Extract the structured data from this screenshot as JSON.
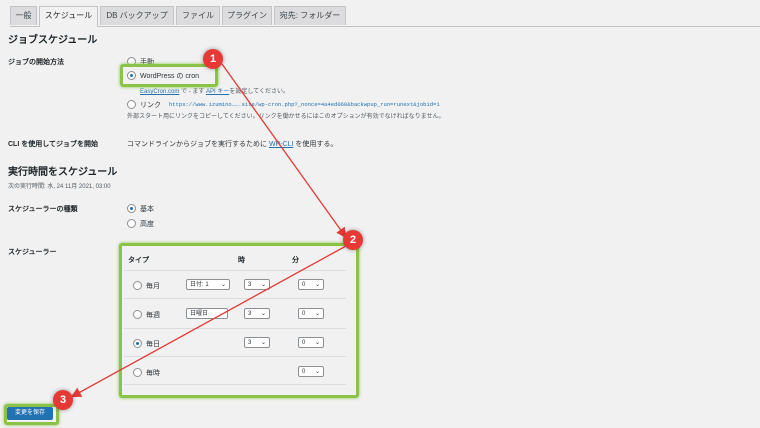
{
  "tabs": [
    "一般",
    "スケジュール",
    "DB バックアップ",
    "ファイル",
    "プラグイン",
    "宛先: フォルダー"
  ],
  "section_job_schedule": "ジョブスケジュール",
  "start_method_label": "ジョブの開始方法",
  "start_options": {
    "first": "手動",
    "wpcron": "WordPress の cron",
    "easycron_note": {
      "link1": "EasyCron.com",
      "mid": " で - ます ",
      "link2": "API キー",
      "tail": "を設定してください。"
    },
    "link_label": "リンク",
    "link_url": "https://www.izumino…….site/wp-cron.php?_nonce=4a4ed060&backwpup_run=runext&jobid=1",
    "link_note": "外部スタート用にリンクをコピーしてください。リンクを働かせるにはこのオプションが有効でなければなりません。"
  },
  "cli_label": "CLI を使用してジョブを開始",
  "cli_text": {
    "pre": "コマンドラインからジョブを実行するために ",
    "link": "WP-CLI",
    "post": " を使用する。"
  },
  "section_exec": "実行時間をスケジュール",
  "next_run": "次の実行時間: 水, 24 11月 2021, 03:00",
  "scheduler_type_label": "スケジューラーの種類",
  "scheduler_types": [
    "基本",
    "高度"
  ],
  "scheduler_label": "スケジューラー",
  "table_headers": {
    "type": "タイプ",
    "hour": "時",
    "minute": "分"
  },
  "rows": [
    {
      "type": "毎月",
      "day": "日付: 1",
      "hour": "3",
      "minute": "0",
      "checked": false
    },
    {
      "type": "毎週",
      "day": "日曜日",
      "hour": "3",
      "minute": "0",
      "checked": false
    },
    {
      "type": "毎日",
      "hour": "3",
      "minute": "0",
      "checked": true
    },
    {
      "type": "毎時",
      "minute": "0",
      "checked": false
    }
  ],
  "save_button": "変更を保存",
  "badges": [
    "1",
    "2",
    "3"
  ],
  "colors": {
    "highlight": "#8bc34a",
    "badge": "#e53935",
    "accent": "#2271b1"
  }
}
